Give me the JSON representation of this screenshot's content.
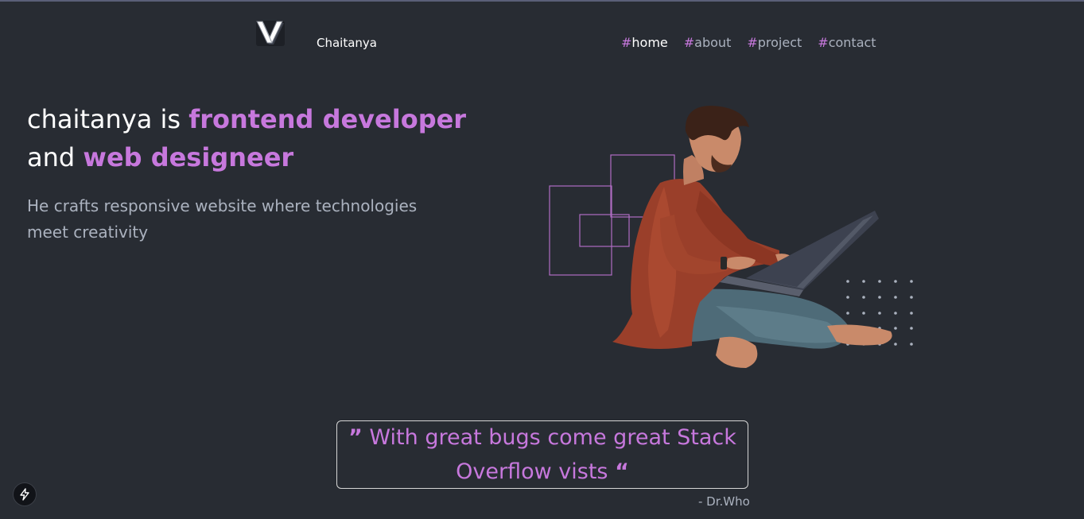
{
  "header": {
    "brand": "Chaitanya",
    "nav": [
      {
        "hash": "#",
        "label": "home",
        "active": true
      },
      {
        "hash": "#",
        "label": "about",
        "active": false
      },
      {
        "hash": "#",
        "label": "project",
        "active": false
      },
      {
        "hash": "#",
        "label": "contact",
        "active": false
      }
    ]
  },
  "hero": {
    "title_part1": "chaitanya is ",
    "title_accent1": "frontend developer",
    "title_part2": "and ",
    "title_accent2": "web designeer",
    "subtitle": "He crafts responsive website where technologies meet creativity"
  },
  "quote": {
    "open_mark": "”",
    "text": " With great bugs come great Stack Overflow vists ",
    "close_mark": "“",
    "author": "- Dr.Who"
  },
  "icons": {
    "logo": "v-logo-icon",
    "fab": "lightning-icon"
  },
  "colors": {
    "background": "#282c33",
    "accent": "#c778dd",
    "muted_text": "#abb2bf",
    "text": "#ffffff"
  }
}
